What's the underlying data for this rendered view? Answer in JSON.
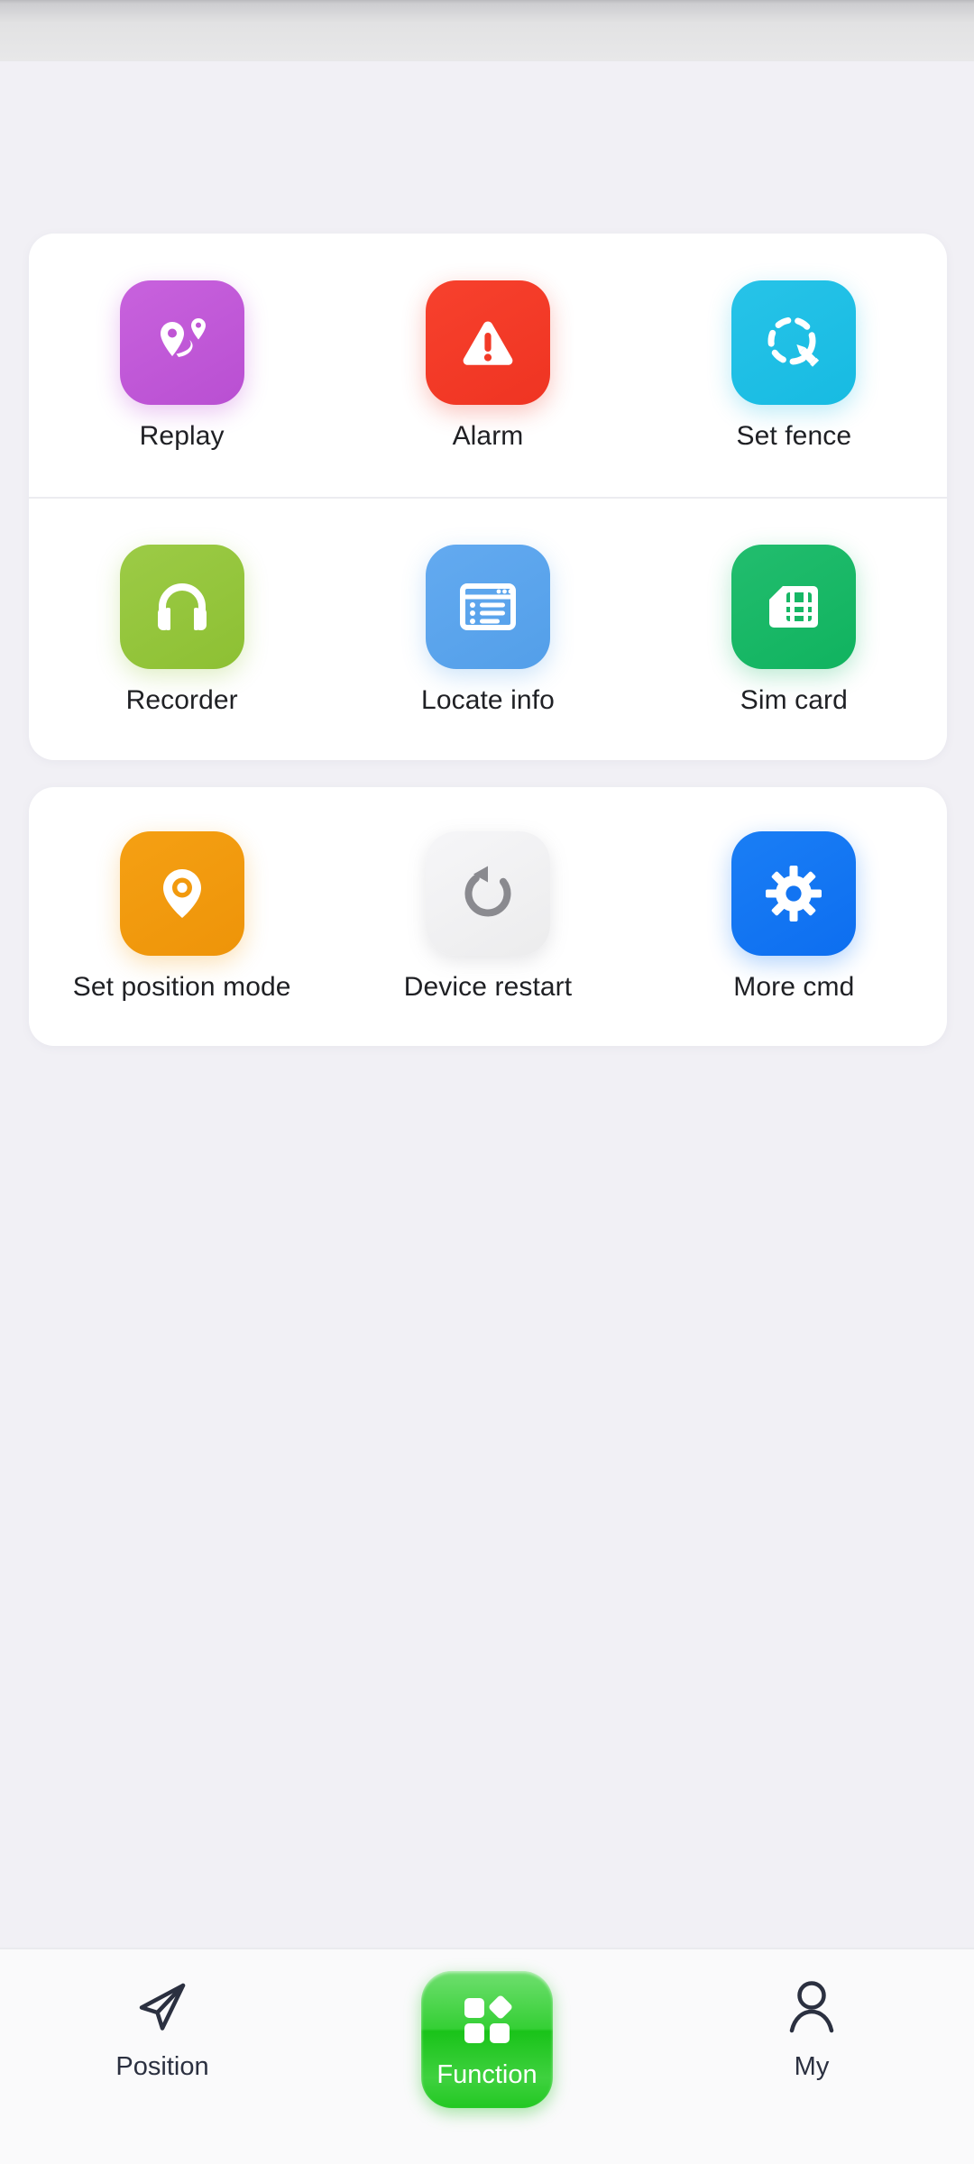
{
  "app": {
    "background_color": "#f1f0f5",
    "card_color": "#ffffff"
  },
  "status_bar": {
    "content": ""
  },
  "main": {
    "cards": [
      {
        "rows": [
          {
            "items": [
              {
                "label": "Replay",
                "icon": "route-pins-icon",
                "color": "#bf55d4"
              },
              {
                "label": "Alarm",
                "icon": "warning-triangle-icon",
                "color": "#f23a27"
              },
              {
                "label": "Set fence",
                "icon": "dashed-circle-pencil-icon",
                "color": "#1fbfe5"
              }
            ]
          },
          {
            "items": [
              {
                "label": "Recorder",
                "icon": "headphones-icon",
                "color": "#94c53c"
              },
              {
                "label": "Locate info",
                "icon": "window-list-icon",
                "color": "#5ba4ec"
              },
              {
                "label": "Sim card",
                "icon": "sim-card-icon",
                "color": "#17b765"
              }
            ]
          }
        ]
      },
      {
        "rows": [
          {
            "items": [
              {
                "label": "Set position mode",
                "icon": "map-pin-icon",
                "color": "#f29a0e"
              },
              {
                "label": "Device restart",
                "icon": "restart-arrow-icon",
                "color": "#f1f1f3"
              },
              {
                "label": "More cmd",
                "icon": "gear-icon",
                "color": "#1274f2"
              }
            ]
          }
        ]
      }
    ]
  },
  "bottom_nav": {
    "active_index": 1,
    "active_color": "#22c822",
    "items": [
      {
        "label": "Position",
        "icon": "paper-plane-icon",
        "active": false
      },
      {
        "label": "Function",
        "icon": "grid-squares-icon",
        "active": true
      },
      {
        "label": "My",
        "icon": "person-icon",
        "active": false
      }
    ]
  }
}
